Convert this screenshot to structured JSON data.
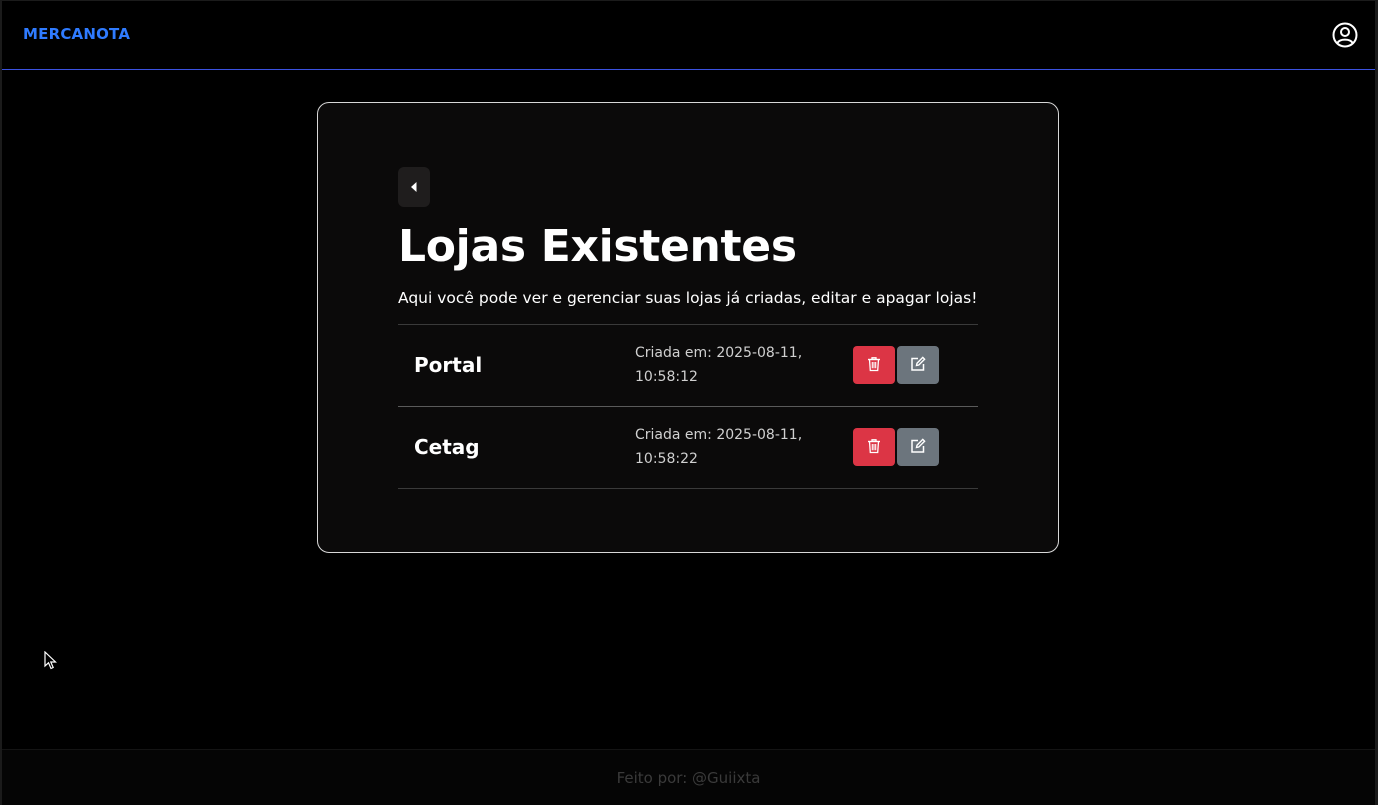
{
  "brand": "MERCANOTA",
  "page": {
    "title": "Lojas Existentes",
    "subtitle": "Aqui você pode ver e gerenciar suas lojas já criadas, editar e apagar lojas!"
  },
  "stores": [
    {
      "name": "Portal",
      "created": "Criada em: 2025-08-11, 10:58:12"
    },
    {
      "name": "Cetag",
      "created": "Criada em: 2025-08-11, 10:58:22"
    }
  ],
  "footer": "Feito por: @Guiixta",
  "icons": {
    "user": "user-circle-icon",
    "back": "caret-left-icon",
    "delete": "trash-icon",
    "edit": "edit-icon"
  },
  "colors": {
    "brand": "#2f7bff",
    "nav_border": "#3b52e0",
    "delete": "#dc3545",
    "edit": "#6c757d"
  }
}
